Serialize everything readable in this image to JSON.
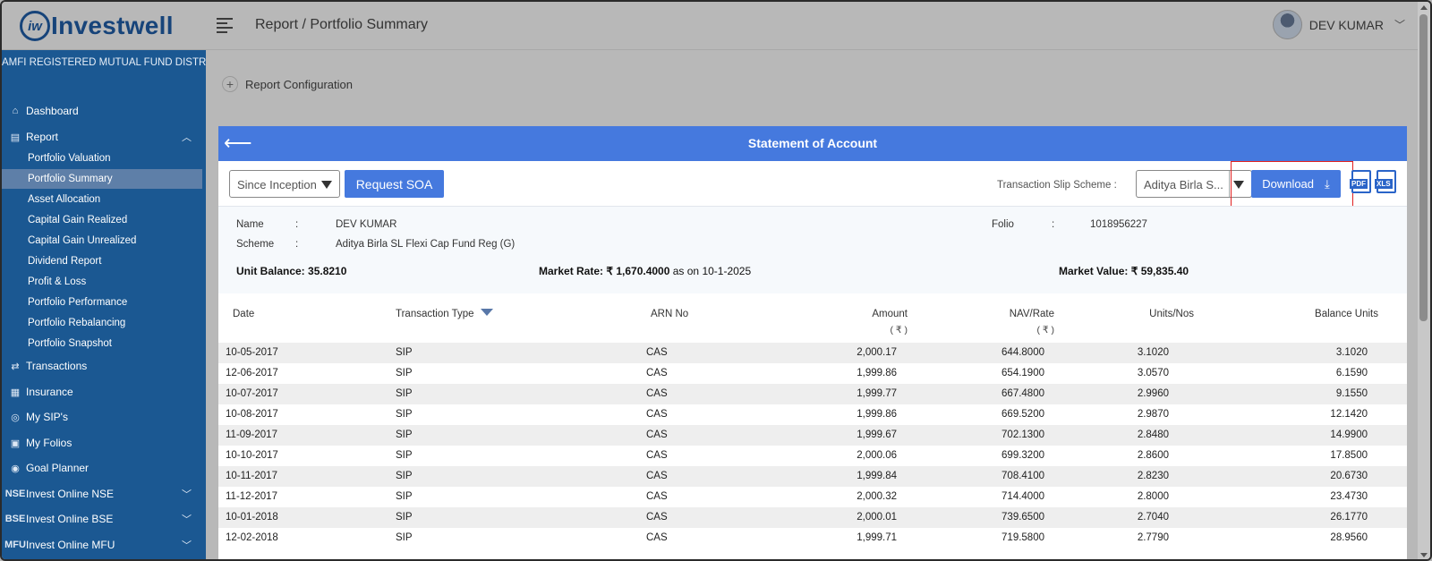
{
  "app": {
    "brand_mark": "iw",
    "brand_name": "Investwell"
  },
  "header": {
    "breadcrumb": "Report / Portfolio Summary",
    "user_name": "DEV KUMAR"
  },
  "sidebar": {
    "tagline": "AMFI REGISTERED MUTUAL FUND DISTRIBUTOR",
    "items": [
      {
        "label": "Dashboard",
        "icon": "home-icon"
      },
      {
        "label": "Report",
        "icon": "report-icon"
      },
      {
        "label": "Transactions",
        "icon": "swap-icon"
      },
      {
        "label": "Insurance",
        "icon": "insurance-icon"
      },
      {
        "label": "My SIP's",
        "icon": "sip-icon"
      },
      {
        "label": "My Folios",
        "icon": "folios-icon"
      },
      {
        "label": "Goal Planner",
        "icon": "goal-icon"
      },
      {
        "label": "Invest Online NSE",
        "icon": "nse-icon",
        "icon_text": "NSE"
      },
      {
        "label": "Invest Online BSE",
        "icon": "bse-icon",
        "icon_text": "BSE"
      },
      {
        "label": "Invest Online MFU",
        "icon": "mfu-icon",
        "icon_text": "MFU"
      }
    ],
    "report_subitems": [
      "Portfolio Valuation",
      "Portfolio Summary",
      "Asset Allocation",
      "Capital Gain Realized",
      "Capital Gain Unrealized",
      "Dividend Report",
      "Profit & Loss",
      "Portfolio Performance",
      "Portfolio Rebalancing",
      "Portfolio Snapshot"
    ]
  },
  "config": {
    "label": "Report Configuration"
  },
  "statement": {
    "title": "Statement of Account",
    "period_select": "Since Inception",
    "request_button": "Request SOA",
    "slip_label": "Transaction Slip Scheme :",
    "scheme_select": "Aditya Birla S...",
    "download_button": "Download",
    "pdf_label": "PDF",
    "xls_label": "XLS"
  },
  "info": {
    "name_label": "Name",
    "name_value": "DEV KUMAR",
    "scheme_label": "Scheme",
    "scheme_value": "Aditya Birla SL Flexi Cap Fund Reg (G)",
    "folio_label": "Folio",
    "folio_value": "1018956227",
    "colon": ":",
    "unit_balance_label": "Unit Balance:",
    "unit_balance_value": "35.8210",
    "market_rate_label": "Market Rate:",
    "market_rate_value": "₹ 1,670.4000",
    "market_rate_suffix": "as on 10-1-2025",
    "market_value_label": "Market Value:",
    "market_value_value": "₹ 59,835.40"
  },
  "table": {
    "headers": {
      "date": "Date",
      "type": "Transaction Type",
      "arn": "ARN No",
      "amount": "Amount",
      "amount_unit": "( ₹ )",
      "nav": "NAV/Rate",
      "nav_unit": "( ₹ )",
      "units": "Units/Nos",
      "balance": "Balance Units"
    },
    "rows": [
      [
        "10-05-2017",
        "SIP",
        "CAS",
        "2,000.17",
        "644.8000",
        "3.1020",
        "3.1020"
      ],
      [
        "12-06-2017",
        "SIP",
        "CAS",
        "1,999.86",
        "654.1900",
        "3.0570",
        "6.1590"
      ],
      [
        "10-07-2017",
        "SIP",
        "CAS",
        "1,999.77",
        "667.4800",
        "2.9960",
        "9.1550"
      ],
      [
        "10-08-2017",
        "SIP",
        "CAS",
        "1,999.86",
        "669.5200",
        "2.9870",
        "12.1420"
      ],
      [
        "11-09-2017",
        "SIP",
        "CAS",
        "1,999.67",
        "702.1300",
        "2.8480",
        "14.9900"
      ],
      [
        "10-10-2017",
        "SIP",
        "CAS",
        "2,000.06",
        "699.3200",
        "2.8600",
        "17.8500"
      ],
      [
        "10-11-2017",
        "SIP",
        "CAS",
        "1,999.84",
        "708.4100",
        "2.8230",
        "20.6730"
      ],
      [
        "11-12-2017",
        "SIP",
        "CAS",
        "2,000.32",
        "714.4000",
        "2.8000",
        "23.4730"
      ],
      [
        "10-01-2018",
        "SIP",
        "CAS",
        "2,000.01",
        "739.6500",
        "2.7040",
        "26.1770"
      ],
      [
        "12-02-2018",
        "SIP",
        "CAS",
        "1,999.71",
        "719.5800",
        "2.7790",
        "28.9560"
      ]
    ]
  }
}
